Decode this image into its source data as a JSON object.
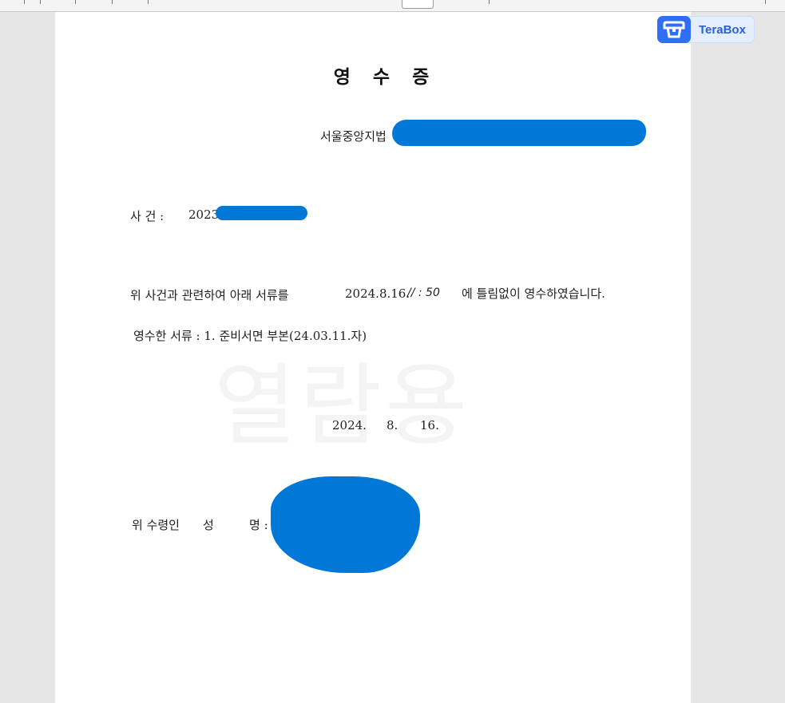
{
  "document": {
    "title": "영 수 증",
    "court": "서울중앙지법",
    "case_label": "사     건 :",
    "case_number": "2023",
    "statement_prefix": "위 사건과 관련하여 아래 서류를",
    "statement_datetime": "2024.8.16.",
    "statement_time_handwritten": "// : 50",
    "statement_suffix": "에 틀림없이 영수하였습니다.",
    "received_docs": "영수한 서류 : 1. 준비서면 부본(24.03.11.자)",
    "date_year": "2024.",
    "date_month": "8.",
    "date_day": "16.",
    "recipient_label": "위 수령인",
    "name_label_1": "성",
    "name_label_2": "명 :",
    "watermark": "열람용"
  },
  "app": {
    "brand": "TeraBox",
    "icon": "terabox-logo-icon",
    "brand_color": "#2f6ef5"
  },
  "colors": {
    "redaction": "#0078d7",
    "background": "#e6e6e6",
    "page": "#ffffff"
  }
}
